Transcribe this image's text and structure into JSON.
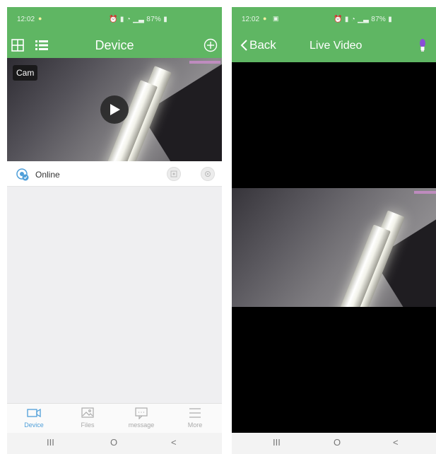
{
  "left_screen": {
    "status_bar": {
      "time": "12:02",
      "battery": "87%"
    },
    "header": {
      "title": "Device"
    },
    "camera": {
      "label": "Cam"
    },
    "device_status": {
      "text": "Online"
    },
    "tabs": [
      {
        "label": "Device",
        "icon": "video-camera-icon",
        "active": true
      },
      {
        "label": "Files",
        "icon": "image-icon",
        "active": false
      },
      {
        "label": "message",
        "icon": "message-icon",
        "active": false
      },
      {
        "label": "More",
        "icon": "menu-icon",
        "active": false
      }
    ]
  },
  "right_screen": {
    "status_bar": {
      "time": "12:02",
      "battery": "87%"
    },
    "header": {
      "back_label": "Back",
      "title": "Live Video"
    }
  },
  "system_nav": {
    "recents": "III",
    "home": "O",
    "back": "<"
  },
  "colors": {
    "header_green": "#5fb663",
    "tab_active": "#4f9fd9",
    "tab_inactive": "#aaaaaa"
  }
}
